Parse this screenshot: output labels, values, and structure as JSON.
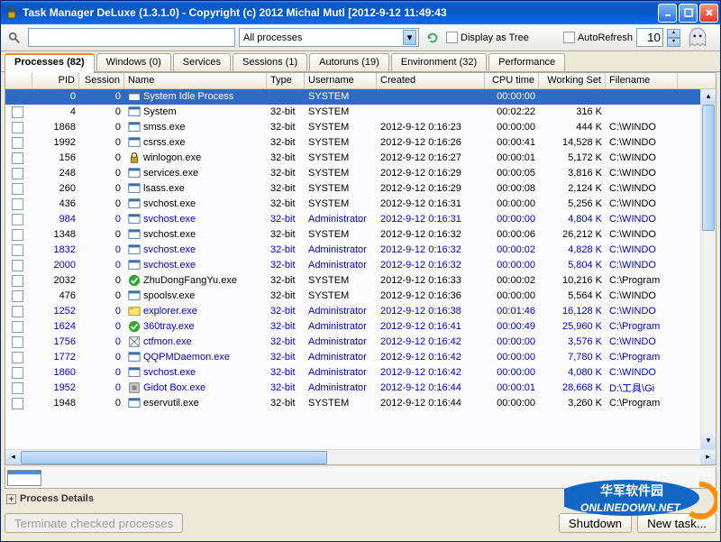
{
  "window": {
    "title": "Task Manager DeLuxe (1.3.1.0) - Copyright (c) 2012 Michal Mutl    [2012-9-12 11:49:43"
  },
  "toolbar": {
    "search_placeholder": "",
    "dropdown_value": "All processes",
    "display_as_tree_label": "Display as Tree",
    "autorefresh_label": "AutoRefresh",
    "refresh_value": "10"
  },
  "tabs": [
    {
      "label": "Processes (82)",
      "active": true
    },
    {
      "label": "Windows (0)",
      "active": false
    },
    {
      "label": "Services",
      "active": false
    },
    {
      "label": "Sessions (1)",
      "active": false
    },
    {
      "label": "Autoruns (19)",
      "active": false
    },
    {
      "label": "Environment (32)",
      "active": false
    },
    {
      "label": "Performance",
      "active": false
    }
  ],
  "columns": [
    "",
    "PID",
    "Session",
    "Name",
    "Type",
    "Username",
    "Created",
    "CPU time",
    "Working Set",
    "Filename"
  ],
  "processes": [
    {
      "pid": "0",
      "session": "0",
      "name": "System Idle Process",
      "type": "",
      "user": "SYSTEM",
      "created": "",
      "cpu": "00:00:00",
      "ws": "",
      "file": "",
      "selected": true,
      "admin": false,
      "icon": "app"
    },
    {
      "pid": "4",
      "session": "0",
      "name": "System",
      "type": "32-bit",
      "user": "SYSTEM",
      "created": "",
      "cpu": "00:02:22",
      "ws": "316 K",
      "file": "",
      "admin": false,
      "icon": "app"
    },
    {
      "pid": "1868",
      "session": "0",
      "name": "smss.exe",
      "type": "32-bit",
      "user": "SYSTEM",
      "created": "2012-9-12 0:16:23",
      "cpu": "00:00:00",
      "ws": "444 K",
      "file": "C:\\WINDO",
      "admin": false,
      "icon": "app"
    },
    {
      "pid": "1992",
      "session": "0",
      "name": "csrss.exe",
      "type": "32-bit",
      "user": "SYSTEM",
      "created": "2012-9-12 0:16:26",
      "cpu": "00:00:41",
      "ws": "14,528 K",
      "file": "C:\\WINDO",
      "admin": false,
      "icon": "app"
    },
    {
      "pid": "156",
      "session": "0",
      "name": "winlogon.exe",
      "type": "32-bit",
      "user": "SYSTEM",
      "created": "2012-9-12 0:16:27",
      "cpu": "00:00:01",
      "ws": "5,172 K",
      "file": "C:\\WINDO",
      "admin": false,
      "icon": "lock"
    },
    {
      "pid": "248",
      "session": "0",
      "name": "services.exe",
      "type": "32-bit",
      "user": "SYSTEM",
      "created": "2012-9-12 0:16:29",
      "cpu": "00:00:05",
      "ws": "3,816 K",
      "file": "C:\\WINDO",
      "admin": false,
      "icon": "app"
    },
    {
      "pid": "260",
      "session": "0",
      "name": "lsass.exe",
      "type": "32-bit",
      "user": "SYSTEM",
      "created": "2012-9-12 0:16:29",
      "cpu": "00:00:08",
      "ws": "2,124 K",
      "file": "C:\\WINDO",
      "admin": false,
      "icon": "app"
    },
    {
      "pid": "436",
      "session": "0",
      "name": "svchost.exe",
      "type": "32-bit",
      "user": "SYSTEM",
      "created": "2012-9-12 0:16:31",
      "cpu": "00:00:00",
      "ws": "5,256 K",
      "file": "C:\\WINDO",
      "admin": false,
      "icon": "app"
    },
    {
      "pid": "984",
      "session": "0",
      "name": "svchost.exe",
      "type": "32-bit",
      "user": "Administrator",
      "created": "2012-9-12 0:16:31",
      "cpu": "00:00:00",
      "ws": "4,804 K",
      "file": "C:\\WINDO",
      "admin": true,
      "icon": "app"
    },
    {
      "pid": "1348",
      "session": "0",
      "name": "svchost.exe",
      "type": "32-bit",
      "user": "SYSTEM",
      "created": "2012-9-12 0:16:32",
      "cpu": "00:00:06",
      "ws": "26,212 K",
      "file": "C:\\WINDO",
      "admin": false,
      "icon": "app"
    },
    {
      "pid": "1832",
      "session": "0",
      "name": "svchost.exe",
      "type": "32-bit",
      "user": "Administrator",
      "created": "2012-9-12 0:16:32",
      "cpu": "00:00:02",
      "ws": "4,828 K",
      "file": "C:\\WINDO",
      "admin": true,
      "icon": "app"
    },
    {
      "pid": "2000",
      "session": "0",
      "name": "svchost.exe",
      "type": "32-bit",
      "user": "Administrator",
      "created": "2012-9-12 0:16:32",
      "cpu": "00:00:00",
      "ws": "5,804 K",
      "file": "C:\\WINDO",
      "admin": true,
      "icon": "app"
    },
    {
      "pid": "2032",
      "session": "0",
      "name": "ZhuDongFangYu.exe",
      "type": "32-bit",
      "user": "SYSTEM",
      "created": "2012-9-12 0:16:33",
      "cpu": "00:00:02",
      "ws": "10,216 K",
      "file": "C:\\Program",
      "admin": false,
      "icon": "shield"
    },
    {
      "pid": "476",
      "session": "0",
      "name": "spoolsv.exe",
      "type": "32-bit",
      "user": "SYSTEM",
      "created": "2012-9-12 0:16:36",
      "cpu": "00:00:00",
      "ws": "5,564 K",
      "file": "C:\\WINDO",
      "admin": false,
      "icon": "app"
    },
    {
      "pid": "1252",
      "session": "0",
      "name": "explorer.exe",
      "type": "32-bit",
      "user": "Administrator",
      "created": "2012-9-12 0:16:38",
      "cpu": "00:01:46",
      "ws": "16,128 K",
      "file": "C:\\WINDO",
      "admin": true,
      "icon": "explorer"
    },
    {
      "pid": "1624",
      "session": "0",
      "name": "360tray.exe",
      "type": "32-bit",
      "user": "Administrator",
      "created": "2012-9-12 0:16:41",
      "cpu": "00:00:49",
      "ws": "25,960 K",
      "file": "C:\\Program",
      "admin": true,
      "icon": "shield"
    },
    {
      "pid": "1756",
      "session": "0",
      "name": "ctfmon.exe",
      "type": "32-bit",
      "user": "Administrator",
      "created": "2012-9-12 0:16:42",
      "cpu": "00:00:00",
      "ws": "3,576 K",
      "file": "C:\\WINDO",
      "admin": true,
      "icon": "ctfmon"
    },
    {
      "pid": "1772",
      "session": "0",
      "name": "QQPMDaemon.exe",
      "type": "32-bit",
      "user": "Administrator",
      "created": "2012-9-12 0:16:42",
      "cpu": "00:00:00",
      "ws": "7,780 K",
      "file": "C:\\Program",
      "admin": true,
      "icon": "app"
    },
    {
      "pid": "1860",
      "session": "0",
      "name": "svchost.exe",
      "type": "32-bit",
      "user": "Administrator",
      "created": "2012-9-12 0:16:42",
      "cpu": "00:00:00",
      "ws": "4,080 K",
      "file": "C:\\WINDO",
      "admin": true,
      "icon": "app"
    },
    {
      "pid": "1952",
      "session": "0",
      "name": "Gidot Box.exe",
      "type": "32-bit",
      "user": "Administrator",
      "created": "2012-9-12 0:16:44",
      "cpu": "00:00:01",
      "ws": "28,668 K",
      "file": "D:\\工具\\Gi",
      "admin": true,
      "icon": "gidot"
    },
    {
      "pid": "1948",
      "session": "0",
      "name": "eservutil.exe",
      "type": "32-bit",
      "user": "SYSTEM",
      "created": "2012-9-12 0:16:44",
      "cpu": "00:00:00",
      "ws": "3,260 K",
      "file": "C:\\Program",
      "admin": false,
      "icon": "app"
    }
  ],
  "details": {
    "label": "Process Details"
  },
  "buttons": {
    "terminate": "Terminate checked processes",
    "shutdown": "Shutdown",
    "newtask": "New task..."
  },
  "watermark": {
    "text1": "华军软件园",
    "text2": "ONLINEDOWN.NET"
  }
}
